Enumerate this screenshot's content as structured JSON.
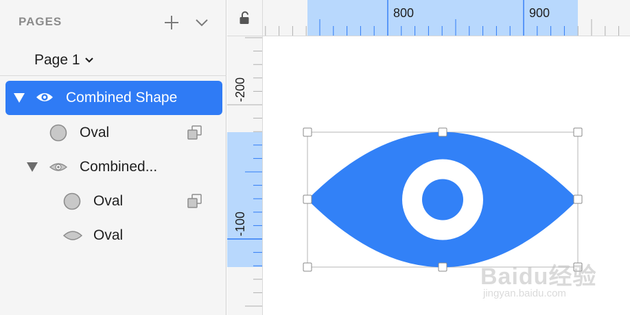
{
  "sidebar": {
    "pages_title": "PAGES",
    "current_page": "Page 1",
    "layers": [
      {
        "name": "Combined Shape",
        "icon": "eye-icon",
        "selected": true,
        "expanded": true
      },
      {
        "name": "Oval",
        "icon": "circle-icon",
        "mask": true
      },
      {
        "name": "Combined...",
        "icon": "eye-icon",
        "expanded": true
      },
      {
        "name": "Oval",
        "icon": "circle-icon",
        "mask": true
      },
      {
        "name": "Oval",
        "icon": "lens-icon"
      }
    ]
  },
  "rulers": {
    "horizontal_labels": [
      "800",
      "900"
    ],
    "vertical_labels": [
      "-200",
      "-100"
    ]
  },
  "colors": {
    "accent": "#2f7bf5",
    "shape_fill": "#3281f7",
    "ruler_highlight": "#b8d8fd"
  },
  "watermark": {
    "main": "Baidu经验",
    "sub": "jingyan.baidu.com"
  }
}
